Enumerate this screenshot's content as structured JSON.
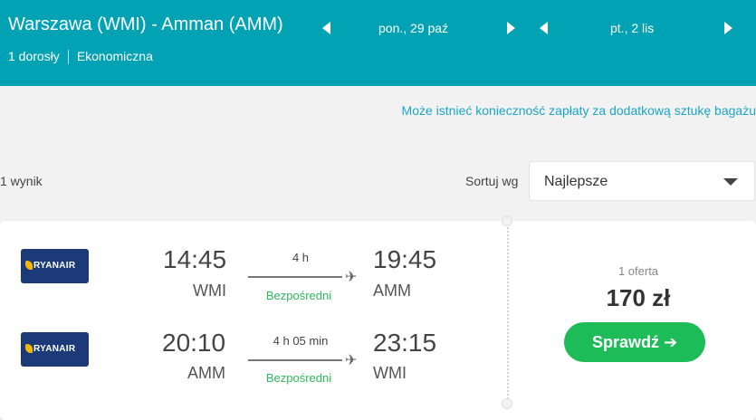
{
  "header": {
    "route": "Warszawa (WMI) - Amman (AMM)",
    "passengers": "1 dorosły",
    "cabin": "Ekonomiczna",
    "outbound_date": "pon., 29 paź",
    "return_date": "pt., 2 lis"
  },
  "notice": "Może istnieć konieczność zapłaty za dodatkową sztukę bagażu",
  "results": {
    "count": "1 wynik",
    "sort_label": "Sortuj wg",
    "sort_value": "Najlepsze"
  },
  "result_card": {
    "legs": [
      {
        "airline": "RYANAIR",
        "depart_time": "14:45",
        "depart_code": "WMI",
        "duration": "4 h",
        "stops": "Bezpośredni",
        "arrive_time": "19:45",
        "arrive_code": "AMM"
      },
      {
        "airline": "RYANAIR",
        "depart_time": "20:10",
        "depart_code": "AMM",
        "duration": "4 h 05 min",
        "stops": "Bezpośredni",
        "arrive_time": "23:15",
        "arrive_code": "WMI"
      }
    ],
    "offers": "1 oferta",
    "price": "170 zł",
    "cta": "Sprawdź ➔"
  },
  "colors": {
    "header_bg": "#00a2b4",
    "cta_green": "#1ebc58",
    "direct_green": "#2fb95a",
    "link_blue": "#1aa6c8",
    "airline_navy": "#1c3a78"
  }
}
